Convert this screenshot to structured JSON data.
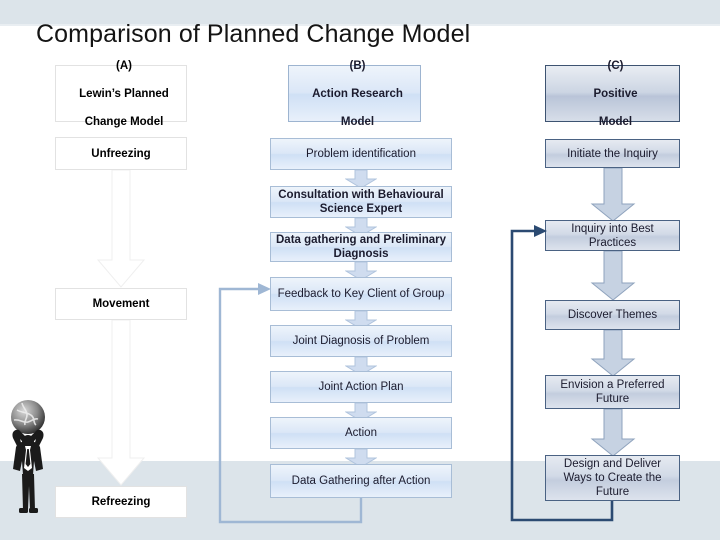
{
  "slide": {
    "title": "Comparison of Planned Change Model",
    "background_color": "#ffffff",
    "band_color": "#dce4ea"
  },
  "columns": [
    {
      "id": "A",
      "header": {
        "tag": "(A)",
        "line1": "Lewin’s Planned",
        "line2": "Change Model",
        "full": "(A)\nLewin’s Planned\nChange Model"
      },
      "accent": "#ffffff",
      "steps": [
        {
          "label": "Unfreezing"
        },
        {
          "label": "Movement"
        },
        {
          "label": "Refreezing"
        }
      ]
    },
    {
      "id": "B",
      "header": {
        "tag": "(B)",
        "line1": "Action Research",
        "line2": "Model",
        "full": "(B)\nAction Research\nModel"
      },
      "accent": "#cfe0f5",
      "steps": [
        {
          "label": "Problem identification"
        },
        {
          "label": "Consultation with Behavioural Science Expert"
        },
        {
          "label": "Data gathering and Preliminary Diagnosis"
        },
        {
          "label": "Feedback to Key Client of Group"
        },
        {
          "label": "Joint Diagnosis of Problem"
        },
        {
          "label": "Joint Action Plan"
        },
        {
          "label": "Action"
        },
        {
          "label": "Data Gathering after Action"
        }
      ],
      "feedback_loop": {
        "from": "Data Gathering after Action",
        "to": "Feedback to Key Client of Group",
        "color": "#9fb7d4"
      }
    },
    {
      "id": "C",
      "header": {
        "tag": "(C)",
        "line1": "Positive",
        "line2": "Model",
        "full": "(C)\nPositive\nModel"
      },
      "accent": "#c3cdde",
      "steps": [
        {
          "label": "Initiate the Inquiry"
        },
        {
          "label": "Inquiry into Best Practices"
        },
        {
          "label": "Discover Themes"
        },
        {
          "label": "Envision a Preferred Future"
        },
        {
          "label": "Design and Deliver Ways to Create the Future"
        }
      ],
      "feedback_loop": {
        "from": "Design and Deliver Ways to Create the Future",
        "to": "Inquiry into Best Practices",
        "color": "#2b4a72"
      }
    }
  ],
  "decoration": {
    "globe_figure": "person-holding-globe"
  }
}
